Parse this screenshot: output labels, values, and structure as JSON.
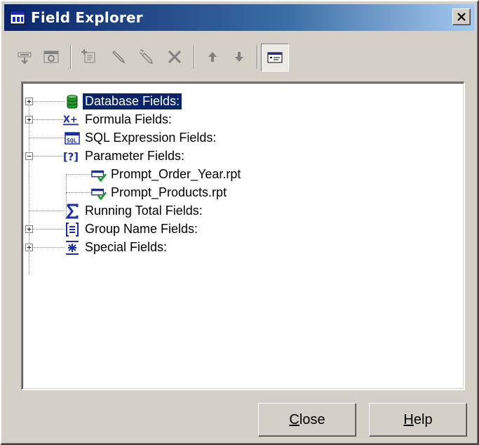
{
  "window": {
    "title": "Field Explorer",
    "title_icon": "field-explorer-icon",
    "close_glyph": "×"
  },
  "toolbar": {
    "buttons": [
      {
        "name": "insert-to-report-button",
        "icon": "insert-field-icon"
      },
      {
        "name": "browse-button",
        "icon": "browse-data-icon"
      },
      {
        "name": "new-button",
        "icon": "new-field-icon"
      },
      {
        "name": "edit-button",
        "icon": "edit-field-icon"
      },
      {
        "name": "rename-button",
        "icon": "rename-field-icon"
      },
      {
        "name": "delete-button",
        "icon": "delete-icon"
      },
      {
        "name": "move-up-button",
        "icon": "arrow-up-icon"
      },
      {
        "name": "move-down-button",
        "icon": "arrow-down-icon"
      },
      {
        "name": "show-field-names-button",
        "icon": "field-names-icon",
        "pressed": true
      }
    ]
  },
  "tree": {
    "nodes": [
      {
        "label": "Database Fields:",
        "icon": "database-icon",
        "expander": "+",
        "selected": true
      },
      {
        "label": "Formula Fields:",
        "icon": "formula-icon",
        "expander": "+"
      },
      {
        "label": "SQL Expression Fields:",
        "icon": "sql-expression-icon",
        "expander": ""
      },
      {
        "label": "Parameter Fields:",
        "icon": "parameter-icon",
        "expander": "−"
      },
      {
        "label": "Prompt_Order_Year.rpt",
        "icon": "parameter-item-icon",
        "expander": ""
      },
      {
        "label": "Prompt_Products.rpt",
        "icon": "parameter-item-icon",
        "expander": ""
      },
      {
        "label": "Running Total Fields:",
        "icon": "running-total-icon",
        "expander": ""
      },
      {
        "label": "Group Name Fields:",
        "icon": "group-name-icon",
        "expander": "+"
      },
      {
        "label": "Special Fields:",
        "icon": "special-fields-icon",
        "expander": "+"
      }
    ]
  },
  "footer": {
    "close_label_mnemonic": "C",
    "close_label_rest": "lose",
    "help_label_mnemonic": "H",
    "help_label_rest": "elp"
  },
  "colors": {
    "title_start": "#0a246a",
    "title_end": "#a6caf0",
    "face": "#d4d0c8",
    "selection": "#0a246a",
    "icon_blue": "#1c2ca8",
    "icon_green": "#1f9a2a"
  }
}
